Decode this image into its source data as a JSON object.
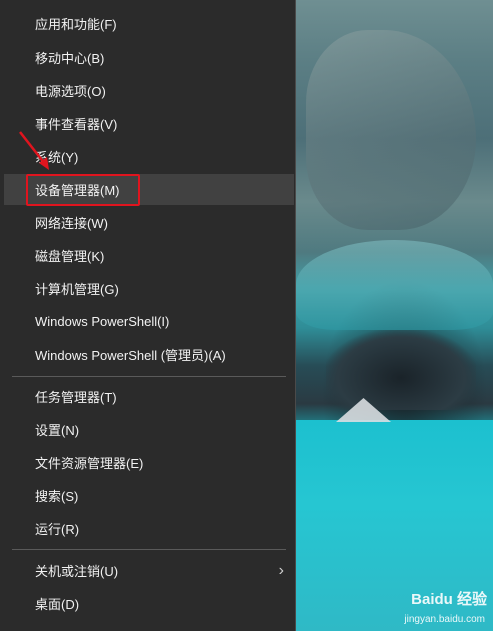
{
  "menu": {
    "items": [
      {
        "label": "应用和功能(F)"
      },
      {
        "label": "移动中心(B)"
      },
      {
        "label": "电源选项(O)"
      },
      {
        "label": "事件查看器(V)"
      },
      {
        "label": "系统(Y)"
      },
      {
        "label": "设备管理器(M)"
      },
      {
        "label": "网络连接(W)"
      },
      {
        "label": "磁盘管理(K)"
      },
      {
        "label": "计算机管理(G)"
      },
      {
        "label": "Windows PowerShell(I)"
      },
      {
        "label": "Windows PowerShell (管理员)(A)"
      },
      {
        "label": "任务管理器(T)"
      },
      {
        "label": "设置(N)"
      },
      {
        "label": "文件资源管理器(E)"
      },
      {
        "label": "搜索(S)"
      },
      {
        "label": "运行(R)"
      },
      {
        "label": "关机或注销(U)"
      },
      {
        "label": "桌面(D)"
      }
    ],
    "highlighted": "设备管理器(M)",
    "submenu_arrow": "chevron-right-icon"
  },
  "watermark": {
    "brand": "Baidu 经验",
    "url": "jingyan.baidu.com"
  },
  "colors": {
    "menu_bg": "#2b2b2b",
    "highlight_border": "#e0141e",
    "annotation_arrow": "#e0141e"
  }
}
